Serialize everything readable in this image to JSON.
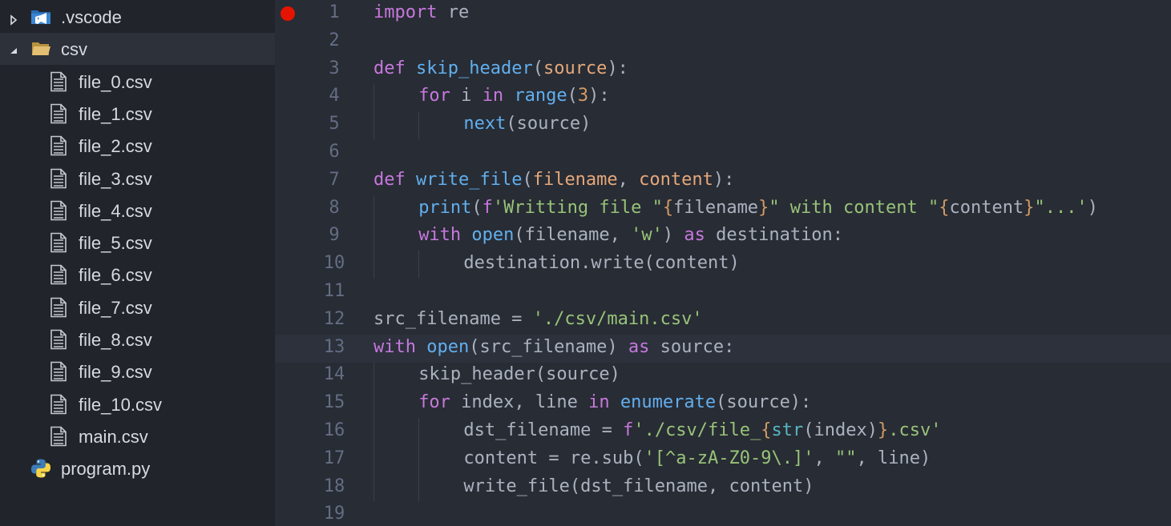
{
  "explorer": {
    "items": [
      {
        "label": ".vscode",
        "type": "folder",
        "icon": "vscode-folder-icon",
        "expanded": false,
        "depth": 0
      },
      {
        "label": "csv",
        "type": "folder",
        "icon": "folder-open-icon",
        "expanded": true,
        "depth": 0,
        "selected": true
      },
      {
        "label": "file_0.csv",
        "type": "file",
        "icon": "file-text-icon",
        "depth": 1
      },
      {
        "label": "file_1.csv",
        "type": "file",
        "icon": "file-text-icon",
        "depth": 1
      },
      {
        "label": "file_2.csv",
        "type": "file",
        "icon": "file-text-icon",
        "depth": 1
      },
      {
        "label": "file_3.csv",
        "type": "file",
        "icon": "file-text-icon",
        "depth": 1
      },
      {
        "label": "file_4.csv",
        "type": "file",
        "icon": "file-text-icon",
        "depth": 1
      },
      {
        "label": "file_5.csv",
        "type": "file",
        "icon": "file-text-icon",
        "depth": 1
      },
      {
        "label": "file_6.csv",
        "type": "file",
        "icon": "file-text-icon",
        "depth": 1
      },
      {
        "label": "file_7.csv",
        "type": "file",
        "icon": "file-text-icon",
        "depth": 1
      },
      {
        "label": "file_8.csv",
        "type": "file",
        "icon": "file-text-icon",
        "depth": 1
      },
      {
        "label": "file_9.csv",
        "type": "file",
        "icon": "file-text-icon",
        "depth": 1
      },
      {
        "label": "file_10.csv",
        "type": "file",
        "icon": "file-text-icon",
        "depth": 1
      },
      {
        "label": "main.csv",
        "type": "file",
        "icon": "file-text-icon",
        "depth": 1
      },
      {
        "label": "program.py",
        "type": "file",
        "icon": "python-icon",
        "depth": 0
      }
    ]
  },
  "editor": {
    "breakpoint_line": 1,
    "current_line": 13,
    "colors": {
      "keyword": "#c678dd",
      "function": "#61afef",
      "parameter": "#e5a87b",
      "number": "#d19a66",
      "string": "#98c379",
      "builtin": "#56b6c2",
      "plain": "#abb2bf",
      "line_number": "#636d83",
      "breakpoint": "#e51400"
    },
    "lines": [
      {
        "num": "1",
        "indent": 0,
        "tokens": [
          [
            "kw",
            "import"
          ],
          [
            "pl",
            " re"
          ]
        ]
      },
      {
        "num": "2",
        "indent": 0,
        "tokens": []
      },
      {
        "num": "3",
        "indent": 0,
        "tokens": [
          [
            "kw",
            "def"
          ],
          [
            "pl",
            " "
          ],
          [
            "fn",
            "skip_header"
          ],
          [
            "pl",
            "("
          ],
          [
            "prm",
            "source"
          ],
          [
            "pl",
            "):"
          ]
        ]
      },
      {
        "num": "4",
        "indent": 1,
        "tokens": [
          [
            "kw",
            "for"
          ],
          [
            "pl",
            " i "
          ],
          [
            "kw",
            "in"
          ],
          [
            "pl",
            " "
          ],
          [
            "fn",
            "range"
          ],
          [
            "pl",
            "("
          ],
          [
            "num",
            "3"
          ],
          [
            "pl",
            "):"
          ]
        ]
      },
      {
        "num": "5",
        "indent": 2,
        "tokens": [
          [
            "fn",
            "next"
          ],
          [
            "pl",
            "(source)"
          ]
        ]
      },
      {
        "num": "6",
        "indent": 0,
        "tokens": []
      },
      {
        "num": "7",
        "indent": 0,
        "tokens": [
          [
            "kw",
            "def"
          ],
          [
            "pl",
            " "
          ],
          [
            "fn",
            "write_file"
          ],
          [
            "pl",
            "("
          ],
          [
            "prm",
            "filename"
          ],
          [
            "pl",
            ", "
          ],
          [
            "prm",
            "content"
          ],
          [
            "pl",
            "):"
          ]
        ]
      },
      {
        "num": "8",
        "indent": 1,
        "tokens": [
          [
            "fn",
            "print"
          ],
          [
            "pl",
            "("
          ],
          [
            "kw",
            "f"
          ],
          [
            "str",
            "'Writting file \""
          ],
          [
            "num",
            "{"
          ],
          [
            "pl",
            "filename"
          ],
          [
            "num",
            "}"
          ],
          [
            "str",
            "\" with content \""
          ],
          [
            "num",
            "{"
          ],
          [
            "pl",
            "content"
          ],
          [
            "num",
            "}"
          ],
          [
            "str",
            "\"...'"
          ],
          [
            "pl",
            ")"
          ]
        ]
      },
      {
        "num": "9",
        "indent": 1,
        "tokens": [
          [
            "kw",
            "with"
          ],
          [
            "pl",
            " "
          ],
          [
            "fn",
            "open"
          ],
          [
            "pl",
            "(filename, "
          ],
          [
            "str",
            "'w'"
          ],
          [
            "pl",
            ") "
          ],
          [
            "kw",
            "as"
          ],
          [
            "pl",
            " destination:"
          ]
        ]
      },
      {
        "num": "10",
        "indent": 2,
        "tokens": [
          [
            "pl",
            "destination.write(content)"
          ]
        ]
      },
      {
        "num": "11",
        "indent": 0,
        "tokens": []
      },
      {
        "num": "12",
        "indent": 0,
        "tokens": [
          [
            "pl",
            "src_filename = "
          ],
          [
            "str",
            "'./csv/main.csv'"
          ]
        ]
      },
      {
        "num": "13",
        "indent": 0,
        "tokens": [
          [
            "kw",
            "with"
          ],
          [
            "pl",
            " "
          ],
          [
            "fn",
            "open"
          ],
          [
            "pl",
            "(src_filename) "
          ],
          [
            "kw",
            "as"
          ],
          [
            "pl",
            " source:"
          ]
        ]
      },
      {
        "num": "14",
        "indent": 1,
        "tokens": [
          [
            "pl",
            "skip_header(source)"
          ]
        ]
      },
      {
        "num": "15",
        "indent": 1,
        "tokens": [
          [
            "kw",
            "for"
          ],
          [
            "pl",
            " index, line "
          ],
          [
            "kw",
            "in"
          ],
          [
            "pl",
            " "
          ],
          [
            "fn",
            "enumerate"
          ],
          [
            "pl",
            "(source):"
          ]
        ]
      },
      {
        "num": "16",
        "indent": 2,
        "tokens": [
          [
            "pl",
            "dst_filename = "
          ],
          [
            "kw",
            "f"
          ],
          [
            "str",
            "'./csv/file_"
          ],
          [
            "num",
            "{"
          ],
          [
            "bi",
            "str"
          ],
          [
            "pl",
            "(index)"
          ],
          [
            "num",
            "}"
          ],
          [
            "str",
            ".csv'"
          ]
        ]
      },
      {
        "num": "17",
        "indent": 2,
        "tokens": [
          [
            "pl",
            "content = re.sub("
          ],
          [
            "str",
            "'[^a-zA-Z0-9\\.]'"
          ],
          [
            "pl",
            ", "
          ],
          [
            "str",
            "\"\""
          ],
          [
            "pl",
            ", line)"
          ]
        ]
      },
      {
        "num": "18",
        "indent": 2,
        "tokens": [
          [
            "pl",
            "write_file(dst_filename, content)"
          ]
        ]
      },
      {
        "num": "19",
        "indent": 0,
        "tokens": []
      }
    ]
  }
}
